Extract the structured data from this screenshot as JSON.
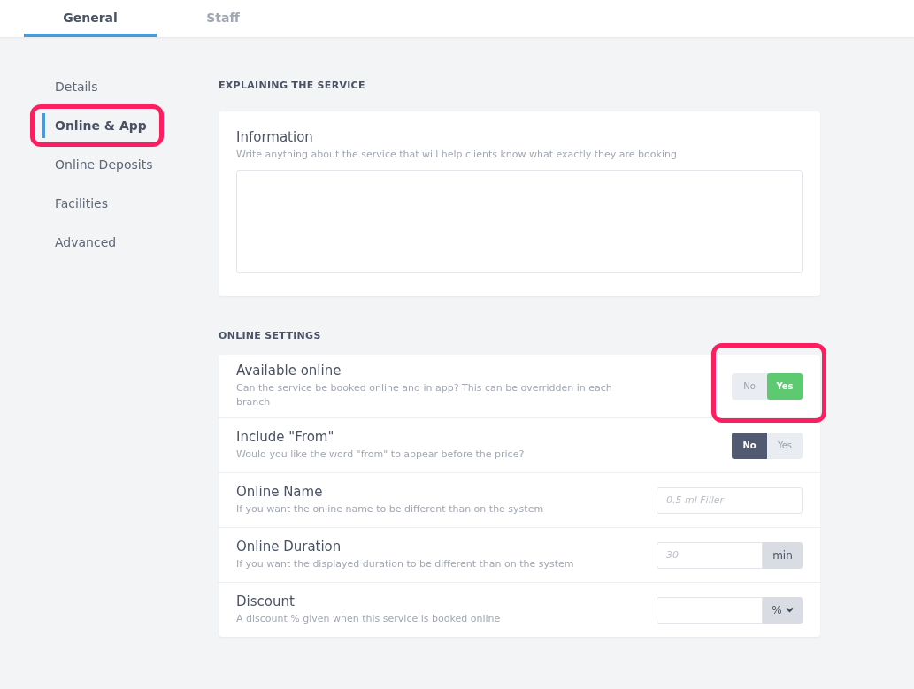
{
  "tabs": [
    {
      "label": "General",
      "selected": true
    },
    {
      "label": "Staff",
      "selected": false
    }
  ],
  "sidebar": {
    "items": [
      {
        "label": "Details",
        "selected": false,
        "highlighted": false
      },
      {
        "label": "Online & App",
        "selected": true,
        "highlighted": true
      },
      {
        "label": "Online Deposits",
        "selected": false,
        "highlighted": false
      },
      {
        "label": "Facilities",
        "selected": false,
        "highlighted": false
      },
      {
        "label": "Advanced",
        "selected": false,
        "highlighted": false
      }
    ]
  },
  "explaining": {
    "heading": "EXPLAINING THE SERVICE",
    "title": "Information",
    "hint": "Write anything about the service that will help clients know what exactly they are booking"
  },
  "online_settings": {
    "heading": "ONLINE SETTINGS",
    "rows": [
      {
        "kind": "toggle",
        "title": "Available online",
        "hint": "Can the service be booked online and in app? This can be overridden in each branch",
        "highlighted": true,
        "options": [
          {
            "label": "No",
            "kind": "no",
            "selected": false
          },
          {
            "label": "Yes",
            "kind": "yes",
            "selected": true
          }
        ]
      },
      {
        "kind": "toggle",
        "title": "Include \"From\"",
        "hint": "Would you like the word \"from\" to appear before the price?",
        "highlighted": false,
        "options": [
          {
            "label": "No",
            "kind": "no",
            "selected": true
          },
          {
            "label": "Yes",
            "kind": "yes",
            "selected": false
          }
        ]
      },
      {
        "kind": "text",
        "title": "Online Name",
        "hint": "If you want the online name to be different than on the system",
        "highlighted": false,
        "placeholder": "0.5 ml Filler"
      },
      {
        "kind": "unit",
        "title": "Online Duration",
        "hint": "If you want the displayed duration to be different than on the system",
        "highlighted": false,
        "placeholder": "30",
        "unit": "min"
      },
      {
        "kind": "select",
        "title": "Discount",
        "hint": "A discount % given when this service is booked online",
        "highlighted": false,
        "unit": "%"
      }
    ]
  }
}
